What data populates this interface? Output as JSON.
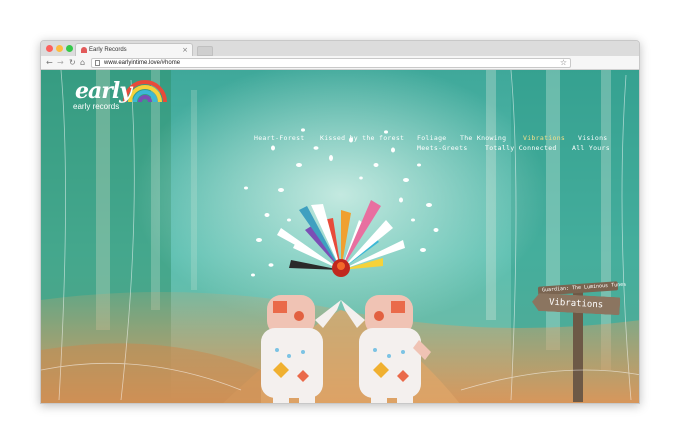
{
  "browser": {
    "tab_title": "Early Records",
    "tab_close": "×",
    "url": "www.earlyintime.love/#home",
    "icons": {
      "back": "arrow-left-icon",
      "forward": "arrow-right-icon",
      "reload": "reload-icon",
      "home": "home-icon",
      "bookmark": "star-icon"
    },
    "traffic_lights": [
      "#fc605c",
      "#fdbc40",
      "#34c84a"
    ]
  },
  "site": {
    "logo": {
      "word": "early",
      "sub": "early records"
    },
    "nav": {
      "row1": [
        "Heart-Forest",
        "Kissed by the forest",
        "Foliage",
        "The Knowing",
        "Vibrations",
        "Visions"
      ],
      "row2": [
        "Meets-Greets",
        "Totally Connected",
        "All Yours"
      ],
      "active": "Vibrations",
      "active_color": "#f4e08a"
    },
    "signpost": {
      "top": "Guardian: The Luminous Tunes",
      "main": "Vibrations"
    },
    "palette": {
      "forest": "#3fa89a",
      "path": "#d9965a",
      "sign": "#8b7560"
    }
  }
}
